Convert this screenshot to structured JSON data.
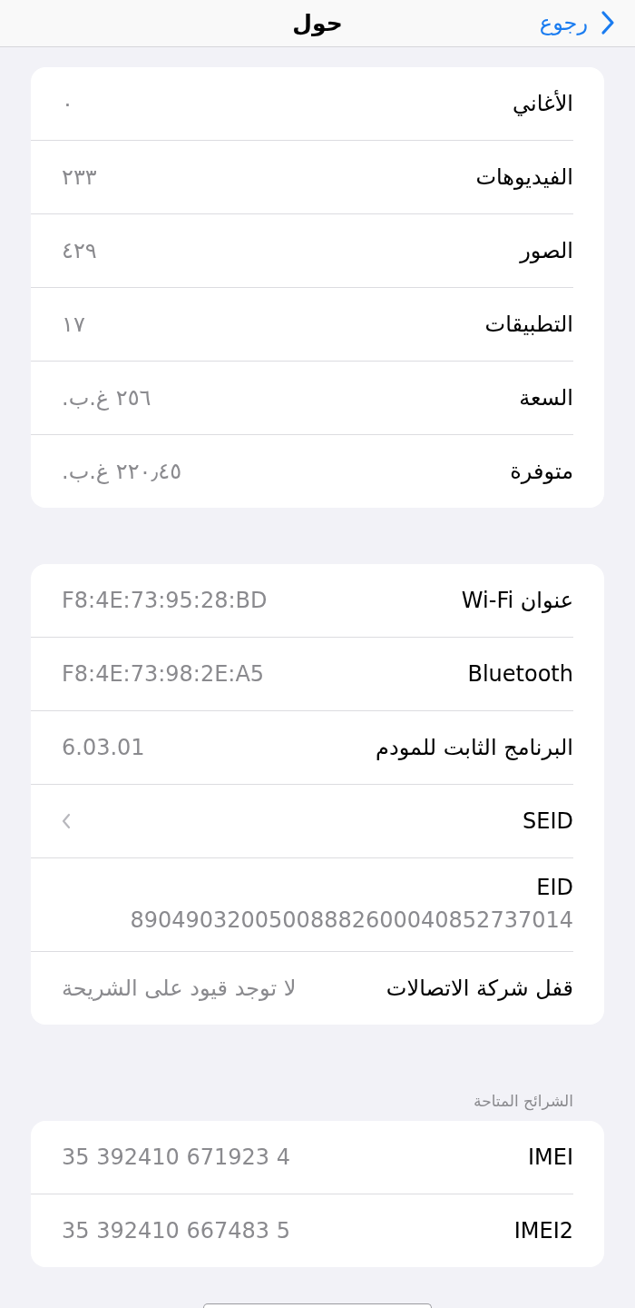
{
  "nav_bar": {
    "back_label": "رجوع",
    "title": "حول"
  },
  "sections": [
    {
      "rows": [
        {
          "kind": "value",
          "label": "الأغاني",
          "value": "٠"
        },
        {
          "kind": "value",
          "label": "الفيديوهات",
          "value": "٢٣٣"
        },
        {
          "kind": "value",
          "label": "الصور",
          "value": "٤٢٩"
        },
        {
          "kind": "value",
          "label": "التطبيقات",
          "value": "١٧"
        },
        {
          "kind": "value",
          "label": "السعة",
          "value": "٢٥٦ غ.ب."
        },
        {
          "kind": "value",
          "label": "متوفرة",
          "value": "٢٢٠٫٤٥ غ.ب."
        }
      ]
    },
    {
      "rows": [
        {
          "kind": "value",
          "label": "عنوان Wi-Fi",
          "value": "F8:4E:73:95:28:BD"
        },
        {
          "kind": "value",
          "label": "Bluetooth",
          "value": "F8:4E:73:98:2E:A5"
        },
        {
          "kind": "value",
          "label": "البرنامج الثابت للمودم",
          "value": "6.03.01"
        },
        {
          "kind": "link",
          "label": "SEID"
        },
        {
          "kind": "stacked",
          "label": "EID",
          "value": "89049032005008882600040852737014"
        },
        {
          "kind": "value",
          "label": "قفل شركة الاتصالات",
          "value": "لا توجد قيود على الشريحة"
        }
      ]
    },
    {
      "header": "الشرائح المتاحة",
      "rows": [
        {
          "kind": "value",
          "label": "IMEI",
          "value": "35 392410 671923 4"
        },
        {
          "kind": "value",
          "label": "IMEI2",
          "value": "35 392410 667483 5"
        }
      ]
    }
  ]
}
